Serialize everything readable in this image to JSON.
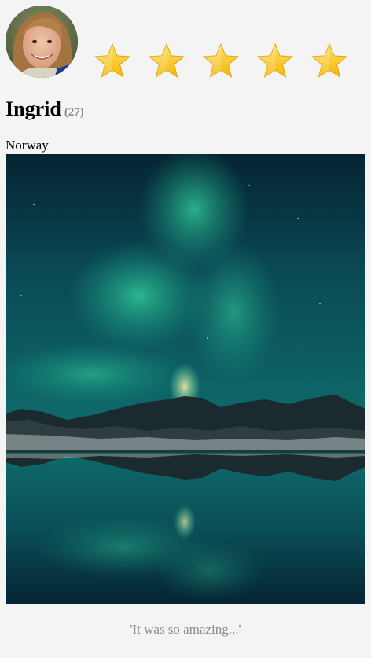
{
  "profile": {
    "name": "Ingrid",
    "age": "(27)",
    "country": "Norway"
  },
  "rating": {
    "stars": 5,
    "max": 5,
    "star_color": "#f7c21d"
  },
  "post": {
    "photo_icon": "aurora-photo",
    "quote": "'It was so amazing...'"
  },
  "colors": {
    "background": "#f4f4f4",
    "muted_text": "#8a8a8a"
  }
}
